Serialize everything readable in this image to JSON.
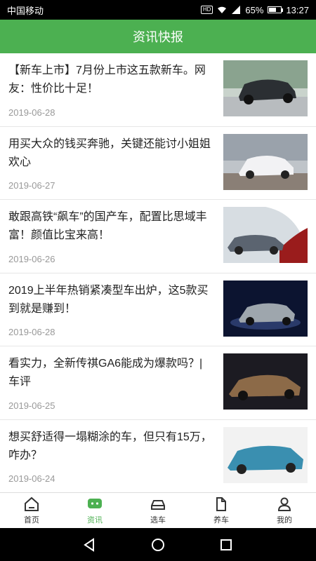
{
  "status": {
    "carrier": "中国移动",
    "hd": "HD",
    "battery_percent": "65%",
    "battery_level": 0.65,
    "time": "13:27"
  },
  "header": {
    "title": "资讯快报"
  },
  "news": [
    {
      "title": "【新车上市】7月份上市这五款新车。网友：性价比十足！",
      "date": "2019-06-28",
      "thumb_color": "#2b2f33"
    },
    {
      "title": "用买大众的钱买奔驰，关键还能讨小姐姐欢心",
      "date": "2019-06-27",
      "thumb_color": "#e8e8ea"
    },
    {
      "title": "敢跟高铁“飙车”的国产车，配置比思域丰富！颜值比宝来高！",
      "date": "2019-06-26",
      "thumb_color": "#5b6470"
    },
    {
      "title": "2019上半年热销紧凑型车出炉，这5款买到就是赚到！",
      "date": "2019-06-28",
      "thumb_color": "#0c1430"
    },
    {
      "title": "看实力，全新传祺GA6能成为爆款吗？| 车评",
      "date": "2019-06-25",
      "thumb_color": "#6b4a2e"
    },
    {
      "title": "想买舒适得一塌糊涂的车，但只有15万，咋办？",
      "date": "2019-06-24",
      "thumb_color": "#3a8fb0"
    }
  ],
  "tabs": [
    {
      "label": "首页",
      "icon": "home-icon"
    },
    {
      "label": "资讯",
      "icon": "chat-icon"
    },
    {
      "label": "选车",
      "icon": "car-icon"
    },
    {
      "label": "养车",
      "icon": "maintenance-icon"
    },
    {
      "label": "我的",
      "icon": "user-icon"
    }
  ],
  "active_tab": 1,
  "colors": {
    "accent": "#4cb051"
  }
}
